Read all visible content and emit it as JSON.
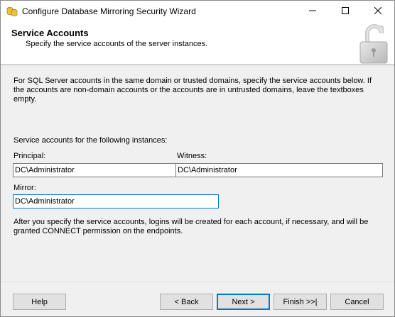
{
  "window": {
    "title": "Configure Database Mirroring Security Wizard",
    "icons": {
      "app": "database-icon",
      "minimize": "minimize-icon",
      "maximize": "maximize-icon",
      "close": "close-icon"
    }
  },
  "header": {
    "title": "Service Accounts",
    "subtitle": "Specify the service accounts of the server instances.",
    "icon": "padlock-icon"
  },
  "content": {
    "description": "For SQL Server accounts in the same domain or trusted domains, specify the service accounts below. If the accounts are non-domain accounts or the accounts are in untrusted domains, leave the textboxes empty.",
    "section_label": "Service accounts for the following instances:",
    "principal": {
      "label": "Principal:",
      "value": "DC\\Administrator"
    },
    "witness": {
      "label": "Witness:",
      "value": "DC\\Administrator"
    },
    "mirror": {
      "label": "Mirror:",
      "value": "DC\\Administrator"
    },
    "note": "After you specify the service accounts, logins will be created for each account, if necessary, and will be granted CONNECT permission on the endpoints."
  },
  "buttons": {
    "help": "Help",
    "back": "< Back",
    "next": "Next >",
    "finish": "Finish >>|",
    "cancel": "Cancel"
  },
  "colors": {
    "accent": "#0078d7",
    "window_bg": "#f0f0f0",
    "button_bg": "#e1e1e1"
  }
}
